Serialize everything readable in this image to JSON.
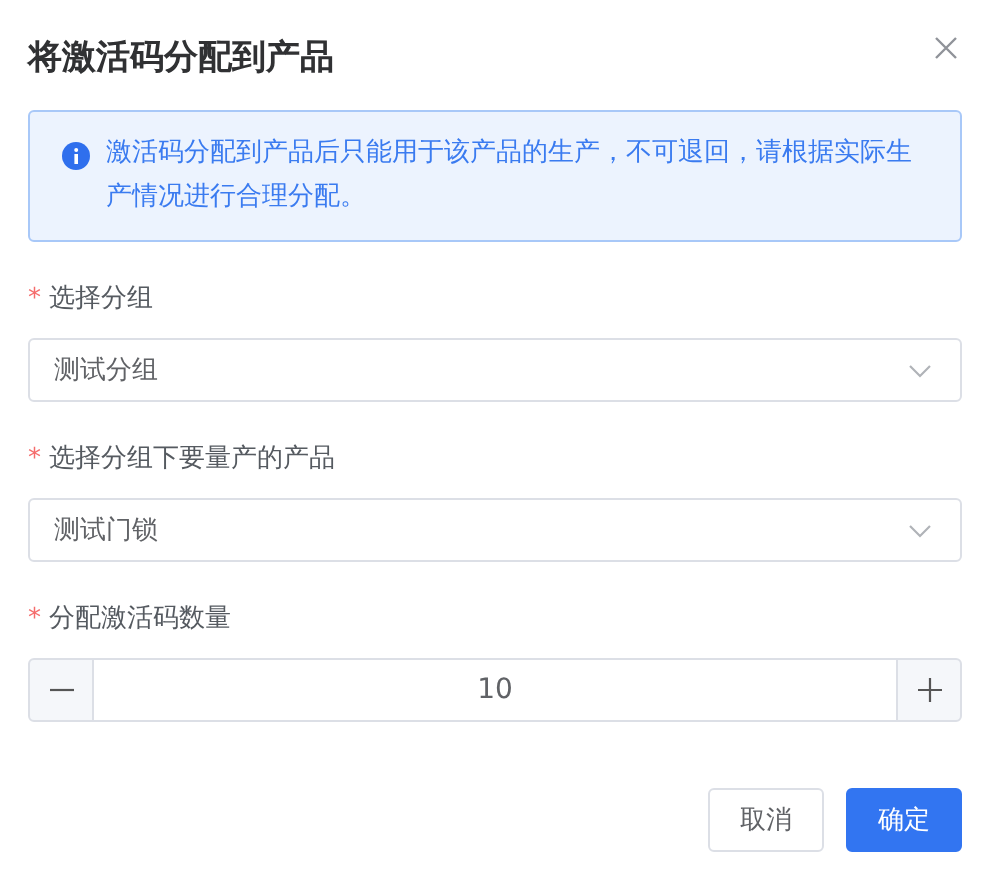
{
  "dialog": {
    "title": "将激活码分配到产品"
  },
  "alert": {
    "text": "激活码分配到产品后只能用于该产品的生产，不可退回，请根据实际生产情况进行合理分配。"
  },
  "fields": [
    {
      "kind": "select",
      "required_mark": "*",
      "label": "选择分组",
      "value": "测试分组"
    },
    {
      "kind": "select",
      "required_mark": "*",
      "label": "选择分组下要量产的产品",
      "value": "测试门锁"
    },
    {
      "kind": "number",
      "required_mark": "*",
      "label": "分配激活码数量",
      "value": "10"
    }
  ],
  "buttons": [
    {
      "label": "取消",
      "kind": "default"
    },
    {
      "label": "确定",
      "kind": "primary"
    }
  ]
}
